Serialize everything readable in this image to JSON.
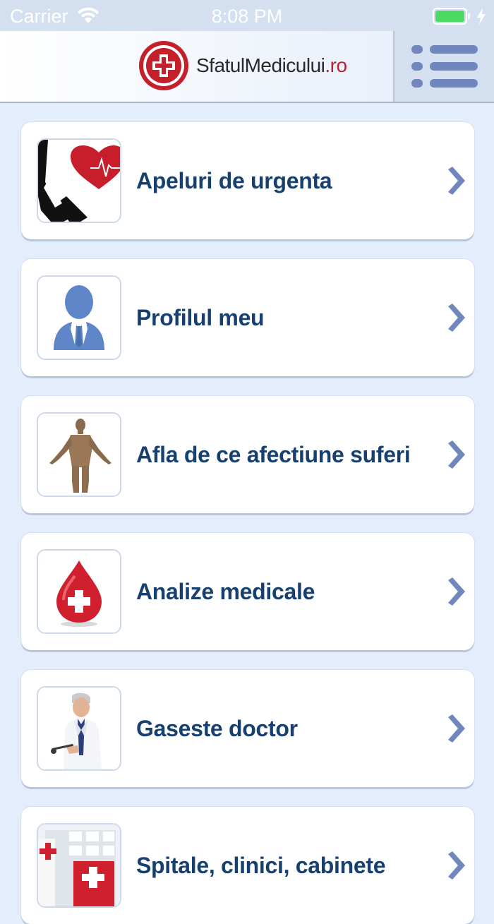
{
  "status_bar": {
    "carrier": "Carrier",
    "time": "8:08 PM",
    "icons": [
      "wifi-icon",
      "battery-icon",
      "charging-bolt-icon"
    ]
  },
  "header": {
    "logo_text_main": "SfatulMedicului",
    "logo_text_tld": ".ro",
    "logo_icon": "red-cross-logo-icon",
    "menu_icon": "hamburger-menu-icon"
  },
  "colors": {
    "background": "#e3edfb",
    "label": "#17406f",
    "chevron": "#6f87bd",
    "brand_red": "#b5232f"
  },
  "menu_items": [
    {
      "label": "Apeluri de urgenta",
      "icon": "phone-heart-icon"
    },
    {
      "label": "Profilul meu",
      "icon": "person-profile-icon"
    },
    {
      "label": "Afla de ce afectiune suferi",
      "icon": "human-body-icon"
    },
    {
      "label": "Analize medicale",
      "icon": "blood-drop-icon"
    },
    {
      "label": "Gaseste doctor",
      "icon": "doctor-icon"
    },
    {
      "label": "Spitale, clinici, cabinete",
      "icon": "hospital-icon"
    }
  ]
}
